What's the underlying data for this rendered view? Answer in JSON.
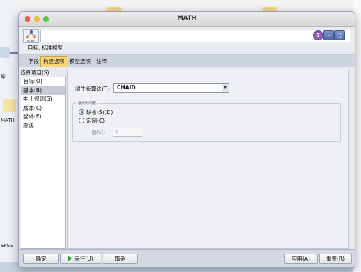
{
  "window": {
    "title": "MATH"
  },
  "header": {
    "target": "目标: 标准模型",
    "logo_text": "CHAID"
  },
  "tabs": [
    {
      "label": "字段",
      "active": false
    },
    {
      "label": "构建选项",
      "active": true
    },
    {
      "label": "模型选项",
      "active": false
    },
    {
      "label": "注释",
      "active": false
    }
  ],
  "select_label": "选择项目(S):",
  "items": [
    {
      "label": "目标(O)",
      "selected": false
    },
    {
      "label": "基本(B)",
      "selected": true
    },
    {
      "label": "中止规则(S)",
      "selected": false
    },
    {
      "label": "成本(C)",
      "selected": false
    },
    {
      "label": "整体(E)",
      "selected": false
    },
    {
      "label": "高级",
      "selected": false
    }
  ],
  "basic": {
    "algorithm_label": "树生长算法(T):",
    "algorithm_value": "CHAID",
    "max_depth": {
      "title": "最大树深度",
      "default_label": "缺省(S)(D)",
      "custom_label": "定制(C)",
      "value_label": "值(V):",
      "value": "5",
      "selected": "default"
    }
  },
  "footer": {
    "ok": "确定",
    "run": "运行(U)",
    "cancel": "取消",
    "apply": "应用(A)",
    "reset": "重置(R)"
  },
  "background": {
    "side_label_1": "型",
    "side_label_2": "MATH",
    "side_label_3": "SPSS",
    "node_logo": "CHAID"
  },
  "colors": {
    "active_tab": "#f8d37a",
    "selected_item": "#c6cbd5",
    "run_icon": "#2f9a3b"
  }
}
